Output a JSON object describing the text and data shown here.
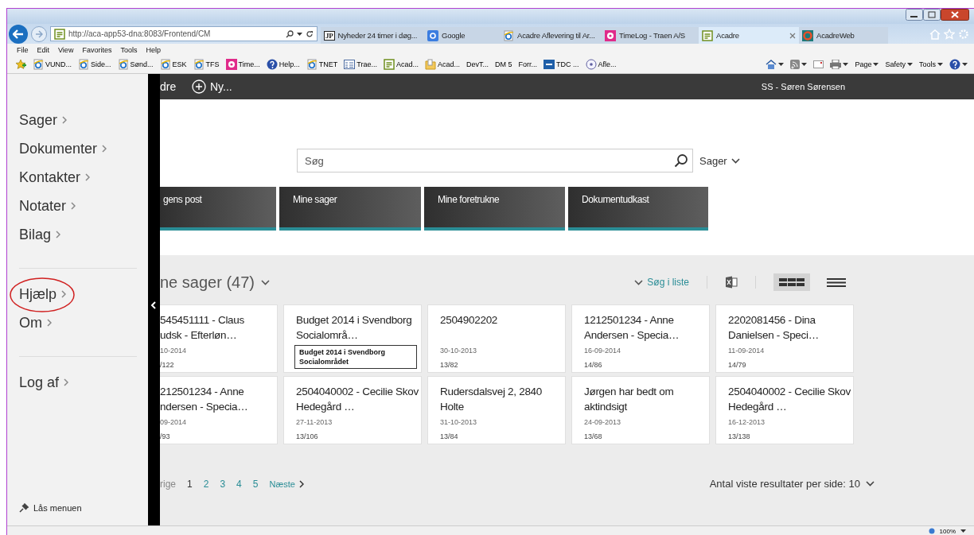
{
  "browser": {
    "address": "http://aca-app53-dna:8083/Frontend/CM",
    "tabs": [
      {
        "label": "Nyheder 24 timer i døg...",
        "selected": false,
        "kind": "jp",
        "icon_text": "JP"
      },
      {
        "label": "Google",
        "selected": false,
        "kind": "google"
      },
      {
        "label": "Acadre Aflevering til Ar...",
        "selected": false,
        "kind": "ie"
      },
      {
        "label": "TimeLog - Traen A/S",
        "selected": false,
        "kind": "flower"
      },
      {
        "label": "Acadre",
        "selected": true,
        "kind": "doc"
      },
      {
        "label": "AcadreWeb",
        "selected": false,
        "kind": "ring"
      }
    ],
    "menu": [
      "File",
      "Edit",
      "View",
      "Favorites",
      "Tools",
      "Help"
    ],
    "favorites": [
      {
        "label": "VUND...",
        "kind": "ie"
      },
      {
        "label": "Side...",
        "kind": "ie"
      },
      {
        "label": "Sønd...",
        "kind": "ie"
      },
      {
        "label": "ESK",
        "kind": "ie"
      },
      {
        "label": "TFS",
        "kind": "ie"
      },
      {
        "label": "Time...",
        "kind": "flower"
      },
      {
        "label": "Help...",
        "kind": "help"
      },
      {
        "label": "TNET",
        "kind": "ie"
      },
      {
        "label": "Trae...",
        "kind": "list"
      },
      {
        "label": "Acad...",
        "kind": "doc"
      },
      {
        "label": "Acad...",
        "kind": "folder"
      },
      {
        "label": "DevT...",
        "kind": "plain"
      },
      {
        "label": "DM 5",
        "kind": "plain"
      },
      {
        "label": "Forr...",
        "kind": "plain"
      },
      {
        "label": "TDC ...",
        "kind": "tdc"
      },
      {
        "label": "Afle...",
        "kind": "disc"
      }
    ],
    "command_bar": [
      "Page",
      "Safety",
      "Tools"
    ]
  },
  "header": {
    "brand": "dre",
    "new_button": "Ny...",
    "user": "SS - Søren Sørensen"
  },
  "sidebar": {
    "items": [
      "Sager",
      "Dokumenter",
      "Kontakter",
      "Notater",
      "Bilag"
    ],
    "secondary": [
      "Hjælp",
      "Om"
    ],
    "logout": "Log af",
    "lock": "Lås menuen"
  },
  "search": {
    "placeholder": "Søg",
    "scope": "Sager"
  },
  "tiles": [
    "gens post",
    "Mine sager",
    "Mine foretrukne",
    "Dokumentudkast"
  ],
  "list": {
    "title": "ne sager (47)",
    "search_in_list": "Søg i liste",
    "views": [
      {
        "kind": "grid",
        "selected": true
      },
      {
        "kind": "list",
        "selected": false
      }
    ]
  },
  "cards": [
    {
      "title": "545451111 - Claus\nudsk - Efterløn…",
      "date": "10-2014",
      "number": "/122"
    },
    {
      "title": "Budget 2014 i Svendborg Socialområ…",
      "tooltip": "Budget 2014 i Svendborg Socialområdet"
    },
    {
      "title": "2504902202",
      "date": "30-10-2013",
      "number": "13/82"
    },
    {
      "title": "1212501234 - Anne Andersen - Specia…",
      "date": "16-09-2014",
      "number": "14/86"
    },
    {
      "title": "2202081456 - Dina Danielsen - Speci…",
      "date": "11-09-2014",
      "number": "14/79"
    },
    {
      "title": "212501234 - Anne\nndersen - Specia…",
      "date": "09-2014",
      "number": "/93"
    },
    {
      "title": "2504040002 - Cecilie Skov Hedegård …",
      "date": "27-11-2013",
      "number": "13/106"
    },
    {
      "title": "Rudersdalsvej 2, 2840 Holte",
      "date": "31-10-2013",
      "number": "13/84"
    },
    {
      "title": "Jørgen har bedt om aktindsigt",
      "date": "24-09-2013",
      "number": "13/68"
    },
    {
      "title": "2504040002 - Cecilie Skov Hedegård …",
      "date": "16-12-2013",
      "number": "13/138"
    }
  ],
  "pagination": {
    "previous": "rige",
    "pages": [
      {
        "label": "1",
        "selected": true
      },
      {
        "label": "2",
        "selected": false
      },
      {
        "label": "3",
        "selected": false
      },
      {
        "label": "4",
        "selected": false
      },
      {
        "label": "5",
        "selected": false
      }
    ],
    "next": "Næste"
  },
  "page_size": "Antal viste resultater per side: 10",
  "status_bar": {
    "zoom": "100%"
  }
}
